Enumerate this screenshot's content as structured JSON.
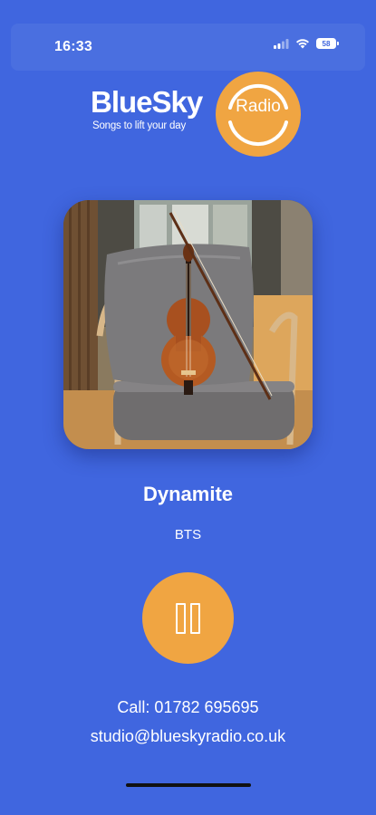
{
  "status_bar": {
    "time": "16:33",
    "battery": "58",
    "icons": [
      "signal-icon",
      "wifi-icon",
      "battery-icon"
    ]
  },
  "logo": {
    "wordmark": "BlueSky",
    "tagline": "Songs to lift your day",
    "badge": "Radio"
  },
  "artwork": {
    "description_icon": "album-art-violin-on-chair"
  },
  "now_playing": {
    "title": "Dynamite",
    "artist": "BTS",
    "state": "playing"
  },
  "controls": {
    "pause_icon": "pause-icon"
  },
  "contact": {
    "phone": "Call: 01782 695695",
    "email": "studio@blueskyradio.co.uk"
  },
  "colors": {
    "background": "#4066df",
    "accent": "#f0a542",
    "text": "#ffffff"
  }
}
